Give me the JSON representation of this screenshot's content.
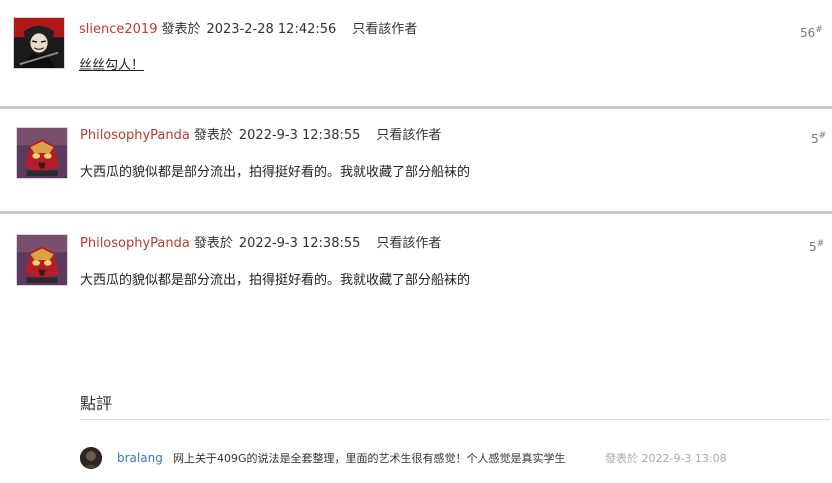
{
  "posts": [
    {
      "author": "slience2019",
      "posted_label": "發表於",
      "time": "2023-2-28 12:42:56",
      "author_only": "只看該作者",
      "floor": "56",
      "floor_mark": "#",
      "content": "丝丝勾人！",
      "avatar_icon": "masked-figure-icon"
    },
    {
      "author": "PhilosophyPanda",
      "posted_label": "發表於",
      "time": "2022-9-3 12:38:55",
      "author_only": "只看該作者",
      "floor": "5",
      "floor_mark": "#",
      "content": "大西瓜的貌似都是部分流出，拍得挺好看的。我就收藏了部分船袜的",
      "avatar_icon": "armored-rider-icon"
    },
    {
      "author": "PhilosophyPanda",
      "posted_label": "發表於",
      "time": "2022-9-3 12:38:55",
      "author_only": "只看該作者",
      "floor": "5",
      "floor_mark": "#",
      "content": "大西瓜的貌似都是部分流出，拍得挺好看的。我就收藏了部分船袜的",
      "avatar_icon": "armored-rider-icon"
    }
  ],
  "review": {
    "title": "點評",
    "comments": [
      {
        "user": "bralang",
        "text": "网上关于409G的说法是全套整理，里面的艺术生很有感觉！个人感觉是真实学生",
        "posted_label": "發表於",
        "time": "2022-9-3 13:08",
        "avatar_icon": "user-avatar-icon"
      }
    ]
  },
  "colors": {
    "author": "#c0392b",
    "review_user": "#3a7bbf",
    "divider": "#c9c9c9",
    "muted": "#aaaaaa"
  }
}
